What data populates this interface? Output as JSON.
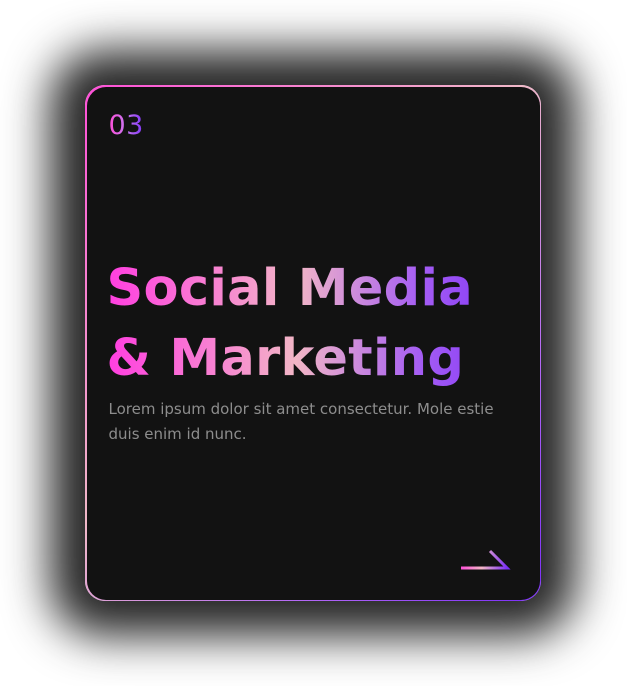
{
  "card": {
    "number": "03",
    "title_line1": "Social Media",
    "title_line2": "& Marketing",
    "description": "Lorem ipsum dolor sit amet consectetur. Mole estie duis enim id nunc.",
    "arrow_icon": "arrow-right-icon",
    "colors": {
      "background": "#121212",
      "gradient_start": "#ff4fd8",
      "gradient_mid": "#f0b8c8",
      "gradient_end": "#7b2ff7",
      "description_text": "#8d8d8d"
    }
  }
}
